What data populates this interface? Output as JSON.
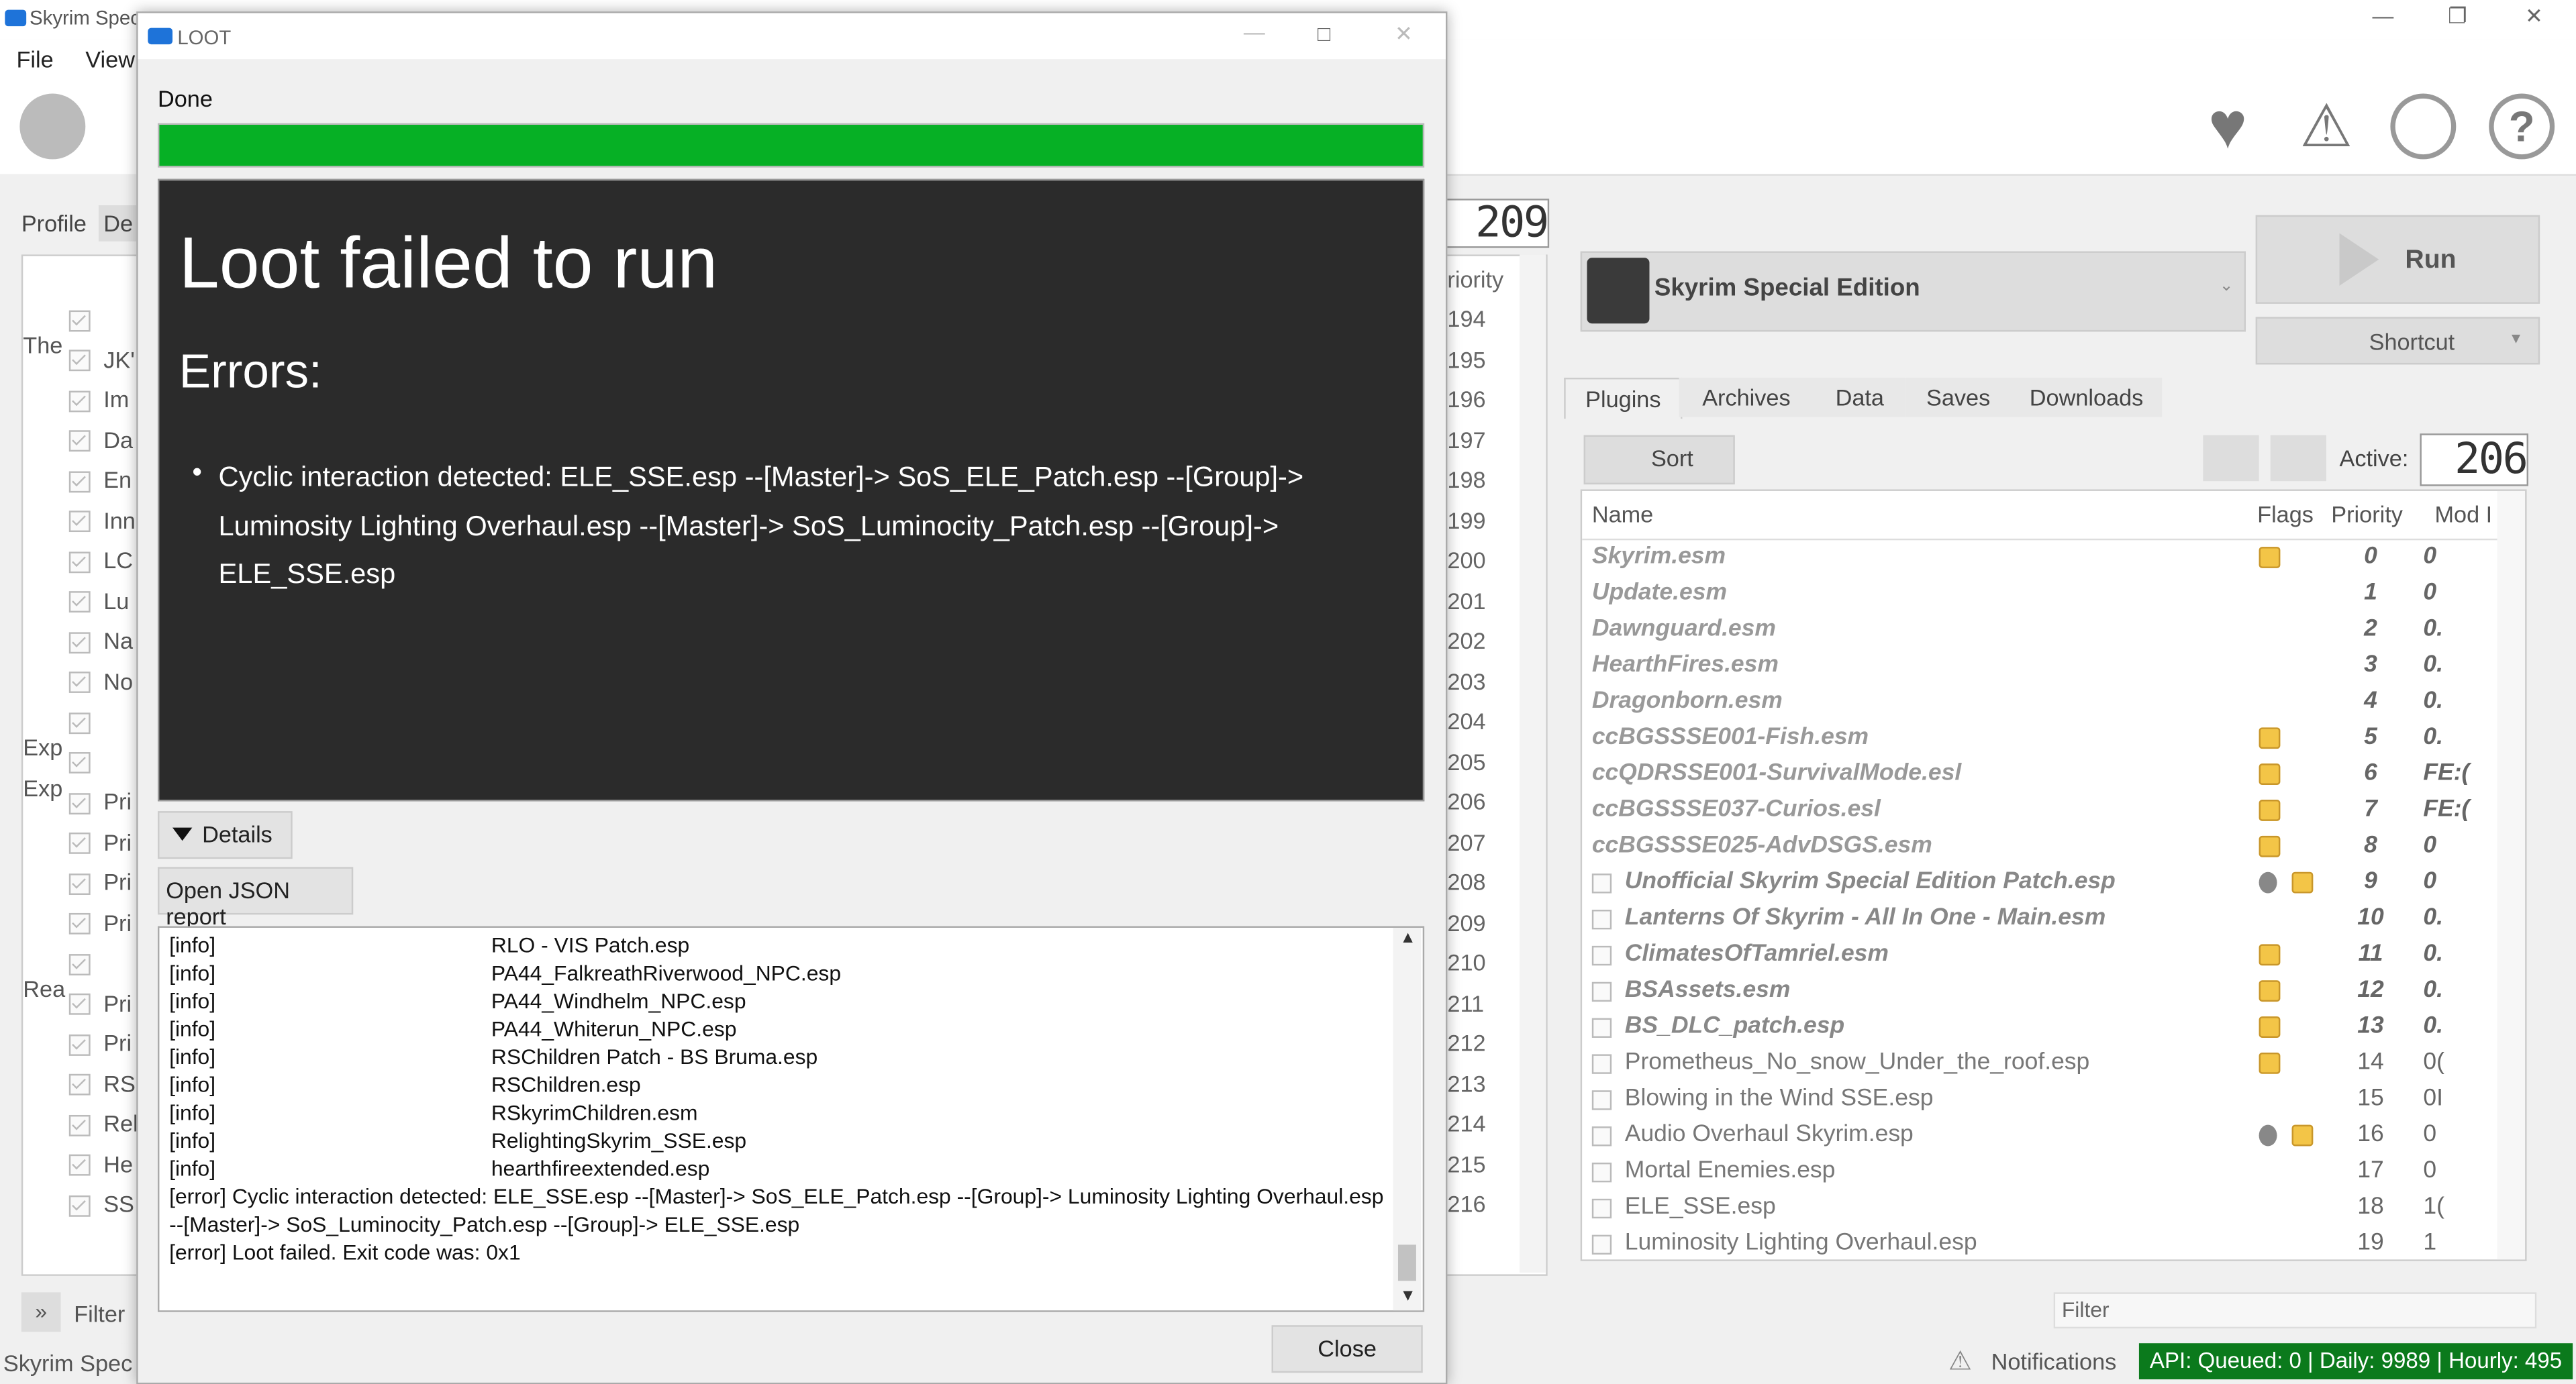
{
  "mo_window": {
    "title": "Skyrim Spec",
    "menu": [
      "File",
      "View"
    ],
    "left_tabs": [
      "Profile",
      "De"
    ],
    "left_list": [
      "The",
      "JK'",
      "Im",
      "Da",
      "En",
      "Inn",
      "LC",
      "Lu",
      "Na",
      "No",
      "Exp",
      "Exp",
      "Pri",
      "Pri",
      "Pri",
      "Pri",
      "Rea",
      "Pri",
      "Pri",
      "RS",
      "Rel",
      "He",
      "SS"
    ],
    "counter_top": "209",
    "priority_header": "riority",
    "priority_values": [
      "194",
      "195",
      "196",
      "197",
      "198",
      "199",
      "200",
      "201",
      "202",
      "203",
      "204",
      "205",
      "206",
      "207",
      "208",
      "209",
      "210",
      "211",
      "212",
      "213",
      "214",
      "215",
      "216"
    ],
    "filter_label": "Filter",
    "status_left": "Skyrim Spec",
    "game_name": "Skyrim Special Edition",
    "run_label": "Run",
    "shortcut_label": "Shortcut",
    "right_tabs": [
      "Plugins",
      "Archives",
      "Data",
      "Saves",
      "Downloads"
    ],
    "sort_label": "Sort",
    "active_label": "Active:",
    "active_count": "206",
    "table_headers": {
      "name": "Name",
      "flags": "Flags",
      "priority": "Priority",
      "mod_index": "Mod I"
    },
    "plugins": [
      {
        "name": "Skyrim.esm",
        "priority": "0",
        "mod": "0",
        "user": false,
        "plain": false,
        "flags": [
          "esm"
        ]
      },
      {
        "name": "Update.esm",
        "priority": "1",
        "mod": "0",
        "user": false,
        "plain": false,
        "flags": []
      },
      {
        "name": "Dawnguard.esm",
        "priority": "2",
        "mod": "0.",
        "user": false,
        "plain": false,
        "flags": []
      },
      {
        "name": "HearthFires.esm",
        "priority": "3",
        "mod": "0.",
        "user": false,
        "plain": false,
        "flags": []
      },
      {
        "name": "Dragonborn.esm",
        "priority": "4",
        "mod": "0.",
        "user": false,
        "plain": false,
        "flags": []
      },
      {
        "name": "ccBGSSSE001-Fish.esm",
        "priority": "5",
        "mod": "0.",
        "user": false,
        "plain": false,
        "flags": [
          "esm"
        ]
      },
      {
        "name": "ccQDRSSE001-SurvivalMode.esl",
        "priority": "6",
        "mod": "FE:(",
        "user": false,
        "plain": false,
        "flags": [
          "esm"
        ]
      },
      {
        "name": "ccBGSSSE037-Curios.esl",
        "priority": "7",
        "mod": "FE:(",
        "user": false,
        "plain": false,
        "flags": [
          "esm"
        ]
      },
      {
        "name": "ccBGSSSE025-AdvDSGS.esm",
        "priority": "8",
        "mod": "0",
        "user": false,
        "plain": false,
        "flags": [
          "esm"
        ]
      },
      {
        "name": "Unofficial Skyrim Special Edition Patch.esp",
        "priority": "9",
        "mod": "0",
        "user": true,
        "plain": false,
        "flags": [
          "script",
          "esm"
        ]
      },
      {
        "name": "Lanterns Of Skyrim - All In One - Main.esm",
        "priority": "10",
        "mod": "0.",
        "user": true,
        "plain": false,
        "flags": []
      },
      {
        "name": "ClimatesOfTamriel.esm",
        "priority": "11",
        "mod": "0.",
        "user": true,
        "plain": false,
        "flags": [
          "esm"
        ]
      },
      {
        "name": "BSAssets.esm",
        "priority": "12",
        "mod": "0.",
        "user": true,
        "plain": false,
        "flags": [
          "esm"
        ]
      },
      {
        "name": "BS_DLC_patch.esp",
        "priority": "13",
        "mod": "0.",
        "user": true,
        "plain": false,
        "flags": [
          "esm"
        ]
      },
      {
        "name": "Prometheus_No_snow_Under_the_roof.esp",
        "priority": "14",
        "mod": "0(",
        "user": true,
        "plain": true,
        "flags": [
          "esm"
        ]
      },
      {
        "name": "Blowing in the Wind SSE.esp",
        "priority": "15",
        "mod": "0I",
        "user": true,
        "plain": true,
        "flags": []
      },
      {
        "name": "Audio Overhaul Skyrim.esp",
        "priority": "16",
        "mod": "0",
        "user": true,
        "plain": true,
        "flags": [
          "script",
          "esm"
        ]
      },
      {
        "name": "Mortal Enemies.esp",
        "priority": "17",
        "mod": "0",
        "user": true,
        "plain": true,
        "flags": []
      },
      {
        "name": "ELE_SSE.esp",
        "priority": "18",
        "mod": "1(",
        "user": true,
        "plain": true,
        "flags": []
      },
      {
        "name": "Luminosity Lighting Overhaul.esp",
        "priority": "19",
        "mod": "1",
        "user": true,
        "plain": true,
        "flags": []
      }
    ],
    "filter_right": "Filter",
    "notifications_label": "Notifications",
    "api_status": "API: Queued: 0 | Daily: 9989 | Hourly: 495"
  },
  "loot": {
    "title": "LOOT",
    "status": "Done",
    "progress": 1.0,
    "error_title": "Loot failed to run",
    "errors_heading": "Errors:",
    "error_message": "Cyclic interaction detected: ELE_SSE.esp --[Master]-> SoS_ELE_Patch.esp --[Group]-> Luminosity Lighting Overhaul.esp --[Master]-> SoS_Luminocity_Patch.esp --[Group]-> ELE_SSE.esp",
    "details_label": "Details",
    "json_report_label": "Open JSON report",
    "log_info": [
      {
        "level": "[info]",
        "text": "RLO - VIS Patch.esp"
      },
      {
        "level": "[info]",
        "text": "PA44_FalkreathRiverwood_NPC.esp"
      },
      {
        "level": "[info]",
        "text": "PA44_Windhelm_NPC.esp"
      },
      {
        "level": "[info]",
        "text": "PA44_Whiterun_NPC.esp"
      },
      {
        "level": "[info]",
        "text": "RSChildren Patch - BS Bruma.esp"
      },
      {
        "level": "[info]",
        "text": "RSChildren.esp"
      },
      {
        "level": "[info]",
        "text": "RSkyrimChildren.esm"
      },
      {
        "level": "[info]",
        "text": "RelightingSkyrim_SSE.esp"
      },
      {
        "level": "[info]",
        "text": "hearthfireextended.esp"
      }
    ],
    "log_error_1": "[error] Cyclic interaction detected: ELE_SSE.esp --[Master]-> SoS_ELE_Patch.esp --[Group]-> Luminosity Lighting Overhaul.esp --[Master]-> SoS_Luminocity_Patch.esp --[Group]-> ELE_SSE.esp",
    "log_error_2": "[error] Loot failed. Exit code was: 0x1",
    "close_label": "Close"
  },
  "colors": {
    "progress": "#06b025",
    "error_bg": "#2b2b2b",
    "api_green": "#0b7a1c"
  }
}
